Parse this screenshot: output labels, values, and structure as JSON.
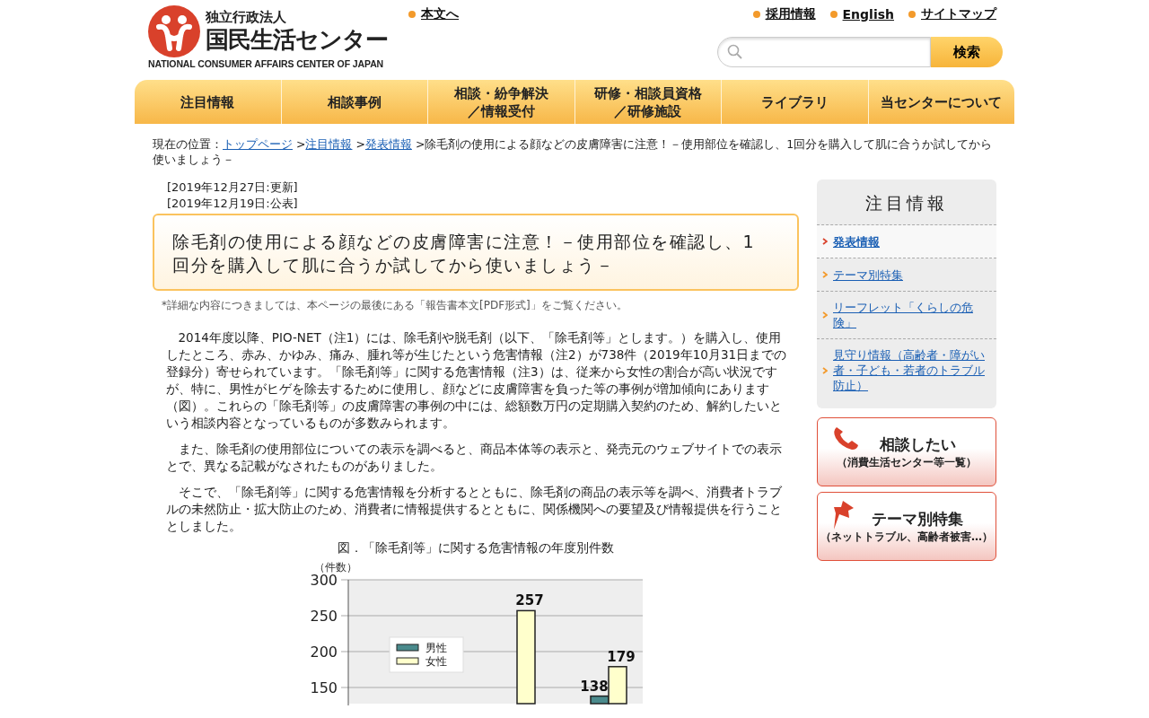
{
  "header": {
    "logo": {
      "org_type": "独立行政法人",
      "name": "国民生活センター",
      "english": "NATIONAL CONSUMER AFFAIRS CENTER OF JAPAN"
    },
    "skip_link": "本文へ",
    "top_links": [
      "採用情報",
      "English",
      "サイトマップ"
    ],
    "search": {
      "button": "検索"
    }
  },
  "nav": [
    {
      "lines": [
        "注目情報"
      ]
    },
    {
      "lines": [
        "相談事例"
      ]
    },
    {
      "lines": [
        "相談・紛争解決",
        "／情報受付"
      ]
    },
    {
      "lines": [
        "研修・相談員資格",
        "／研修施設"
      ]
    },
    {
      "lines": [
        "ライブラリ"
      ]
    },
    {
      "lines": [
        "当センターについて"
      ]
    }
  ],
  "breadcrumb": {
    "prefix": "現在の位置：",
    "separator": ">",
    "links": [
      "トップページ",
      "注目情報",
      "発表情報"
    ],
    "current": "除毛剤の使用による顔などの皮膚障害に注意！－使用部位を確認し、1回分を購入して肌に合うか試してから使いましょう－"
  },
  "dates": [
    "[2019年12月27日:更新]",
    "[2019年12月19日:公表]"
  ],
  "article_title": "除毛剤の使用による顔などの皮膚障害に注意！－使用部位を確認し、1回分を購入して肌に合うか試してから使いましょう－",
  "note": "*詳細な内容につきましては、本ページの最後にある「報告書本文[PDF形式]」をご覧ください。",
  "paragraphs": [
    "2014年度以降、PIO-NET（注1）には、除毛剤や脱毛剤（以下、「除毛剤等」とします。）を購入し、使用したところ、赤み、かゆみ、痛み、腫れ等が生じたという危害情報（注2）が738件（2019年10月31日までの登録分）寄せられています。「除毛剤等」に関する危害情報（注3）は、従来から女性の割合が高い状況ですが、特に、男性がヒゲを除去するために使用し、顔などに皮膚障害を負った等の事例が増加傾向にあります（図）。これらの「除毛剤等」の皮膚障害の事例の中には、総額数万円の定期購入契約のため、解約したいという相談内容となっているものが多数みられます。",
    "また、除毛剤の使用部位についての表示を調べると、商品本体等の表示と、発売元のウェブサイトでの表示とで、異なる記載がなされたものがありました。",
    "そこで、「除毛剤等」に関する危害情報を分析するとともに、除毛剤の商品の表示等を調べ、消費者トラブルの未然防止・拡大防止のため、消費者に情報提供するとともに、関係機関への要望及び情報提供を行うこととしました。"
  ],
  "figure": {
    "caption": "図．「除毛剤等」に関する危害情報の年度別件数",
    "chart_data": {
      "type": "bar",
      "ylabel": "（件数）",
      "ylim": [
        130,
        300
      ],
      "grid": true,
      "legend": true,
      "yticks": [
        150,
        200,
        250,
        300
      ],
      "data_labels": true,
      "series": [
        {
          "name": "男性",
          "color": "#4a8a8c",
          "values": [
            null,
            null,
            138
          ]
        },
        {
          "name": "女性",
          "color": "#ffffcc",
          "values": [
            null,
            257,
            179
          ]
        }
      ]
    }
  },
  "sidebar": {
    "heading": "注目情報",
    "items": [
      {
        "label": "発表情報",
        "selected": true
      },
      {
        "label": "テーマ別特集",
        "selected": false
      },
      {
        "label": "リーフレット「くらしの危険」",
        "selected": false
      },
      {
        "label": "見守り情報（高齢者・障がい者・子ども・若者のトラブル防止）",
        "selected": false
      }
    ],
    "banners": [
      {
        "kind": "phone",
        "title": "相談したい",
        "subtitle": "（消費生活センター等一覧）"
      },
      {
        "kind": "pin",
        "title": "テーマ別特集",
        "subtitle": "（ネットトラブル、高齢者被害…）"
      }
    ]
  }
}
